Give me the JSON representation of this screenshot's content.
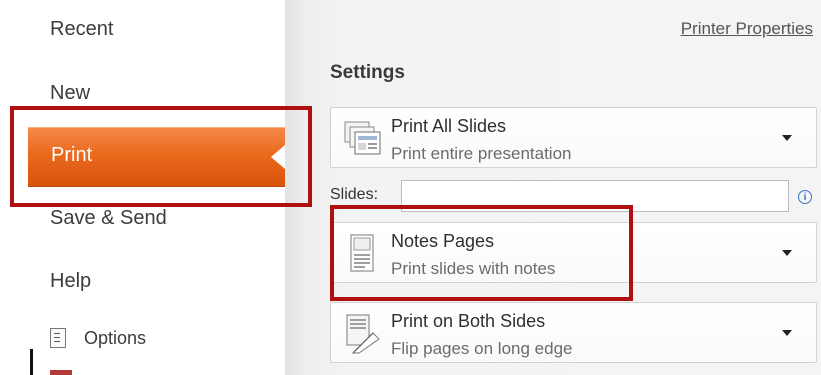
{
  "nav": {
    "recent": "Recent",
    "new": "New",
    "print": "Print",
    "save_send": "Save & Send",
    "help": "Help",
    "options": "Options"
  },
  "panel": {
    "printer_properties": "Printer Properties",
    "settings_heading": "Settings",
    "slides_label": "Slides:",
    "slides_value": "",
    "dropdowns": [
      {
        "title": "Print All Slides",
        "subtitle": "Print entire presentation",
        "icon": "slides-stack-icon"
      },
      {
        "title": "Notes Pages",
        "subtitle": "Print slides with notes",
        "icon": "notes-page-icon"
      },
      {
        "title": "Print on Both Sides",
        "subtitle": "Flip pages on long edge",
        "icon": "duplex-icon"
      }
    ]
  },
  "colors": {
    "print_accent": "#e8661a",
    "highlight_box": "#b00f12",
    "panel_background": "#f4f4f4"
  }
}
